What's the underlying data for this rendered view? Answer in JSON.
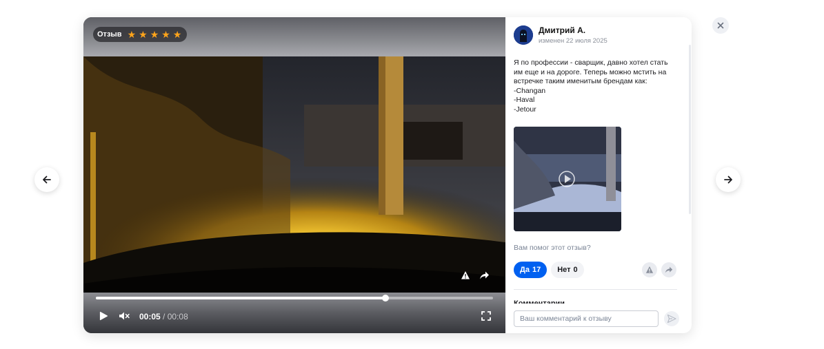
{
  "badge": {
    "label": "Отзыв",
    "rating": 5,
    "stars": [
      "★",
      "★",
      "★",
      "★",
      "★"
    ],
    "star_color": "#ffa41b"
  },
  "video": {
    "current_time": "00:05",
    "separator": " / ",
    "duration": "00:08",
    "progress": 0.73,
    "muted": true
  },
  "review": {
    "author": "Дмитрий А.",
    "date": "изменен 22 июля 2025",
    "text_lines": [
      "Я по профессии - сварщик, давно хотел стать",
      "им еще и на дороге. Теперь можно мстить на",
      "встречке таким именитым брендам как:",
      "-Changan",
      "-Haval",
      "-Jetour"
    ]
  },
  "helpful": {
    "question": "Вам помог этот отзыв?",
    "yes_label": "Да",
    "yes_count": "17",
    "no_label": "Нет",
    "no_count": "0"
  },
  "comments": {
    "heading": "Комментарии",
    "placeholder": "Ваш комментарий к отзыву"
  },
  "icons": {
    "prev": "arrow-left-icon",
    "next": "arrow-right-icon",
    "close": "close-icon",
    "play": "play-icon",
    "mute": "volume-muted-icon",
    "fullscreen": "fullscreen-icon",
    "report": "warning-icon",
    "share": "share-icon",
    "send": "send-icon"
  },
  "colors": {
    "accent": "#0060f0",
    "star": "#ffa41b"
  }
}
